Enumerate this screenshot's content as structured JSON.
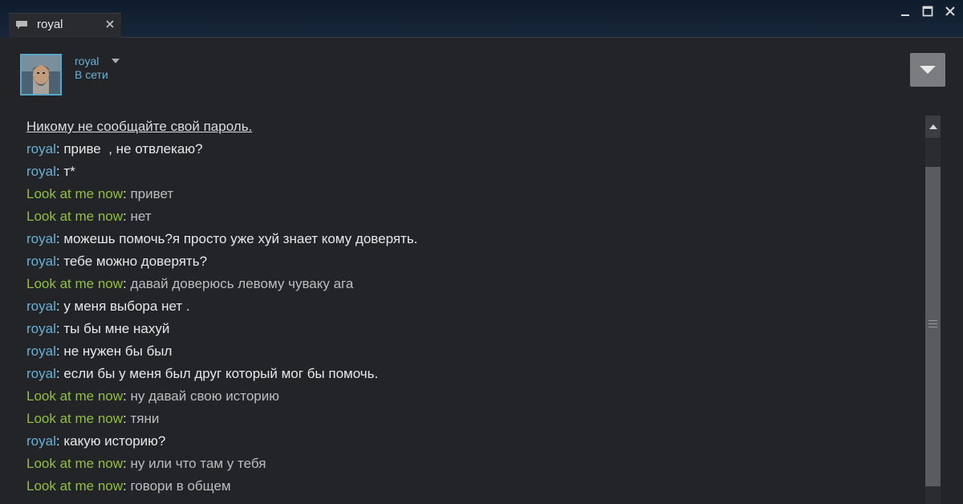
{
  "window": {
    "tab_label": "royal",
    "icons": {
      "tab": "chat-bubble-icon",
      "close_tab": "close-icon",
      "minimize": "minimize-icon",
      "maximize": "maximize-icon",
      "close_window": "close-icon"
    }
  },
  "header": {
    "friend_name": "royal",
    "status": "В сети"
  },
  "chat": {
    "notice": "Никому не сообщайте свой пароль.",
    "messages": [
      {
        "sender": "royal",
        "text": "приве  , не отвлекаю?"
      },
      {
        "sender": "royal",
        "text": "т*"
      },
      {
        "sender": "Look at me now",
        "text": "привет"
      },
      {
        "sender": "Look at me now",
        "text": "нет"
      },
      {
        "sender": "royal",
        "text": "можешь помочь?я просто уже хуй знает кому доверять."
      },
      {
        "sender": "royal",
        "text": "тебе можно доверять?"
      },
      {
        "sender": "Look at me now",
        "text": "давай доверюсь левому чуваку ага"
      },
      {
        "sender": "royal",
        "text": "у меня выбора нет ."
      },
      {
        "sender": "royal",
        "text": "ты бы мне нахуй"
      },
      {
        "sender": "royal",
        "text": "не нужен бы был"
      },
      {
        "sender": "royal",
        "text": "если бы у меня был друг который мог бы помочь."
      },
      {
        "sender": "Look at me now",
        "text": "ну давай свою историю"
      },
      {
        "sender": "Look at me now",
        "text": "тяни"
      },
      {
        "sender": "royal",
        "text": "какую историю?"
      },
      {
        "sender": "Look at me now",
        "text": "ну или что там у тебя"
      },
      {
        "sender": "Look at me now",
        "text": "говори в общем"
      }
    ]
  },
  "colors": {
    "royal": "#69b0d5",
    "me": "#8fc13a",
    "background": "#232427"
  }
}
